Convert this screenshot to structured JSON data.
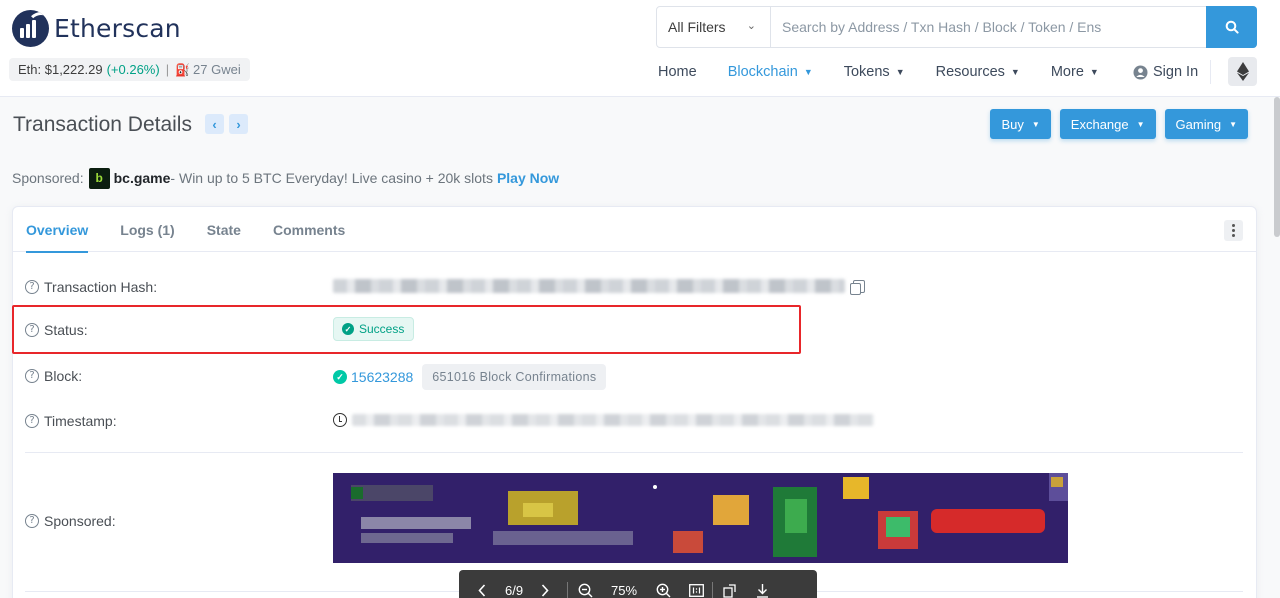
{
  "header": {
    "brand": "Etherscan",
    "price": {
      "label": "Eth: $1,222.29",
      "change": "(+0.26%)",
      "divider": "|",
      "gas": "27 Gwei"
    },
    "search": {
      "filter": "All Filters",
      "placeholder": "Search by Address / Txn Hash / Block / Token / Ens"
    },
    "nav": {
      "home": "Home",
      "blockchain": "Blockchain",
      "tokens": "Tokens",
      "resources": "Resources",
      "more": "More",
      "sign_in": "Sign In"
    }
  },
  "page": {
    "title": "Transaction Details",
    "actions": {
      "buy": "Buy",
      "exchange": "Exchange",
      "gaming": "Gaming"
    }
  },
  "sponsored": {
    "label": "Sponsored:",
    "brand": "bc.game",
    "text": " - Win up to 5 BTC Everyday! Live casino + 20k slots",
    "cta": "Play Now"
  },
  "tabs": [
    "Overview",
    "Logs (1)",
    "State",
    "Comments"
  ],
  "details": {
    "hash_label": "Transaction Hash:",
    "status_label": "Status:",
    "status_value": "Success",
    "block_label": "Block:",
    "block_number": "15623288",
    "confirmations": "651016 Block Confirmations",
    "timestamp_label": "Timestamp:",
    "sponsored_label": "Sponsored:"
  },
  "viewer": {
    "page": "6/9",
    "zoom": "75%"
  },
  "colors": {
    "accent": "#3498db",
    "success": "#00a186",
    "highlight": "#e8262a",
    "brand_dark": "#21325b"
  }
}
